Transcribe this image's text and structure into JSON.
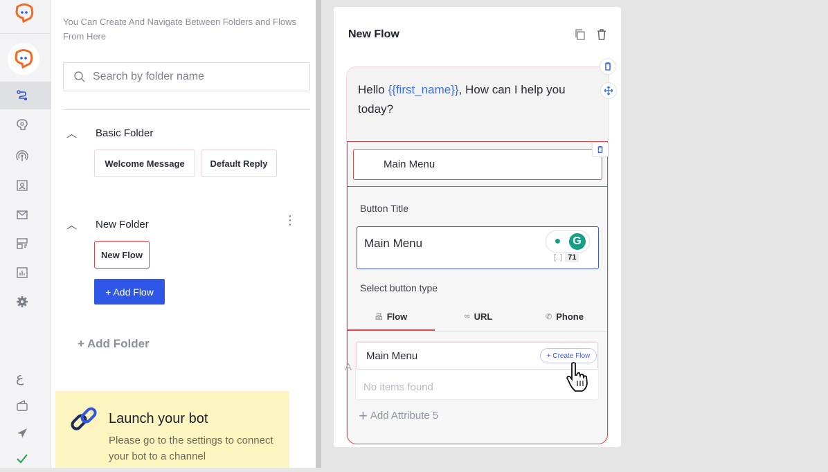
{
  "sidebar_rail": {
    "items": [
      {
        "name": "brand-logo-icon"
      },
      {
        "name": "bot-avatar-icon"
      },
      {
        "name": "flows-icon"
      },
      {
        "name": "ai-brain-icon"
      },
      {
        "name": "broadcast-icon"
      },
      {
        "name": "contacts-icon"
      },
      {
        "name": "inbox-icon"
      },
      {
        "name": "forms-icon"
      },
      {
        "name": "analytics-icon"
      },
      {
        "name": "settings-gear-icon"
      },
      {
        "name": "language-icon",
        "glyph": "ع"
      },
      {
        "name": "wallet-icon"
      },
      {
        "name": "send-icon"
      },
      {
        "name": "check-icon"
      }
    ]
  },
  "panel": {
    "hint": "You Can Create And Navigate Between Folders and Flows From Here",
    "search_placeholder": "Search by folder name",
    "folders": [
      {
        "name": "Basic Folder",
        "flows": [
          "Welcome Message",
          "Default Reply"
        ]
      },
      {
        "name": "New Folder",
        "flows": [
          "New Flow"
        ]
      }
    ],
    "add_flow_label": "+ Add Flow",
    "add_folder_label": "+ Add Folder",
    "launch": {
      "title": "Launch your bot",
      "text": "Please go to the settings to connect your bot to a channel"
    }
  },
  "editor": {
    "title": "New Flow",
    "message_prefix": "Hello ",
    "message_var": "{{first_name}}",
    "message_suffix": ", How can I help you today?",
    "button_label": "Main Menu",
    "button_title_label": "Button Title",
    "button_title_value": "Main Menu",
    "char_count": "71",
    "char_bracket": "[..]",
    "select_type_label": "Select button type",
    "tabs": [
      {
        "label": "Flow",
        "icon": "sitemap-icon",
        "active": true
      },
      {
        "label": "URL",
        "icon": "link-icon",
        "active": false
      },
      {
        "label": "Phone",
        "icon": "phone-icon",
        "active": false
      }
    ],
    "dropdown_value": "Main Menu",
    "create_flow_label": "+ Create Flow",
    "no_items": "No items found",
    "add_attribute_label": "Add Attribute 5"
  },
  "colors": {
    "accent_blue": "#2f57e6",
    "selection_red": "#d74a4a",
    "brand_orange": "#f26a21",
    "launch_bg": "#fdf5bf"
  }
}
